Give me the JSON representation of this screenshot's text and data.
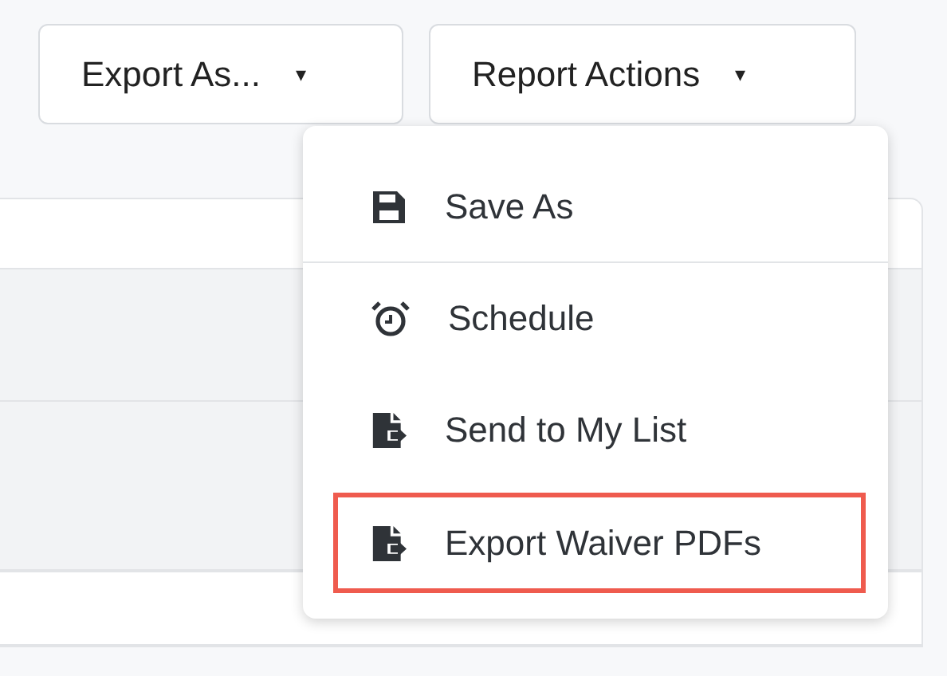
{
  "toolbar": {
    "buttons": [
      {
        "label": "Export As...",
        "caret": "▾"
      },
      {
        "label": "Report Actions",
        "caret": "▾"
      }
    ]
  },
  "menu": {
    "items": [
      {
        "label": "Save As",
        "kind": "save",
        "divider_after": true,
        "highlighted": false
      },
      {
        "label": "Schedule",
        "kind": "schedule",
        "divider_after": false,
        "highlighted": false
      },
      {
        "label": "Send to My List",
        "kind": "export",
        "divider_after": false,
        "highlighted": false
      },
      {
        "label": "Export Waiver PDFs",
        "kind": "export",
        "divider_after": false,
        "highlighted": true
      }
    ]
  }
}
